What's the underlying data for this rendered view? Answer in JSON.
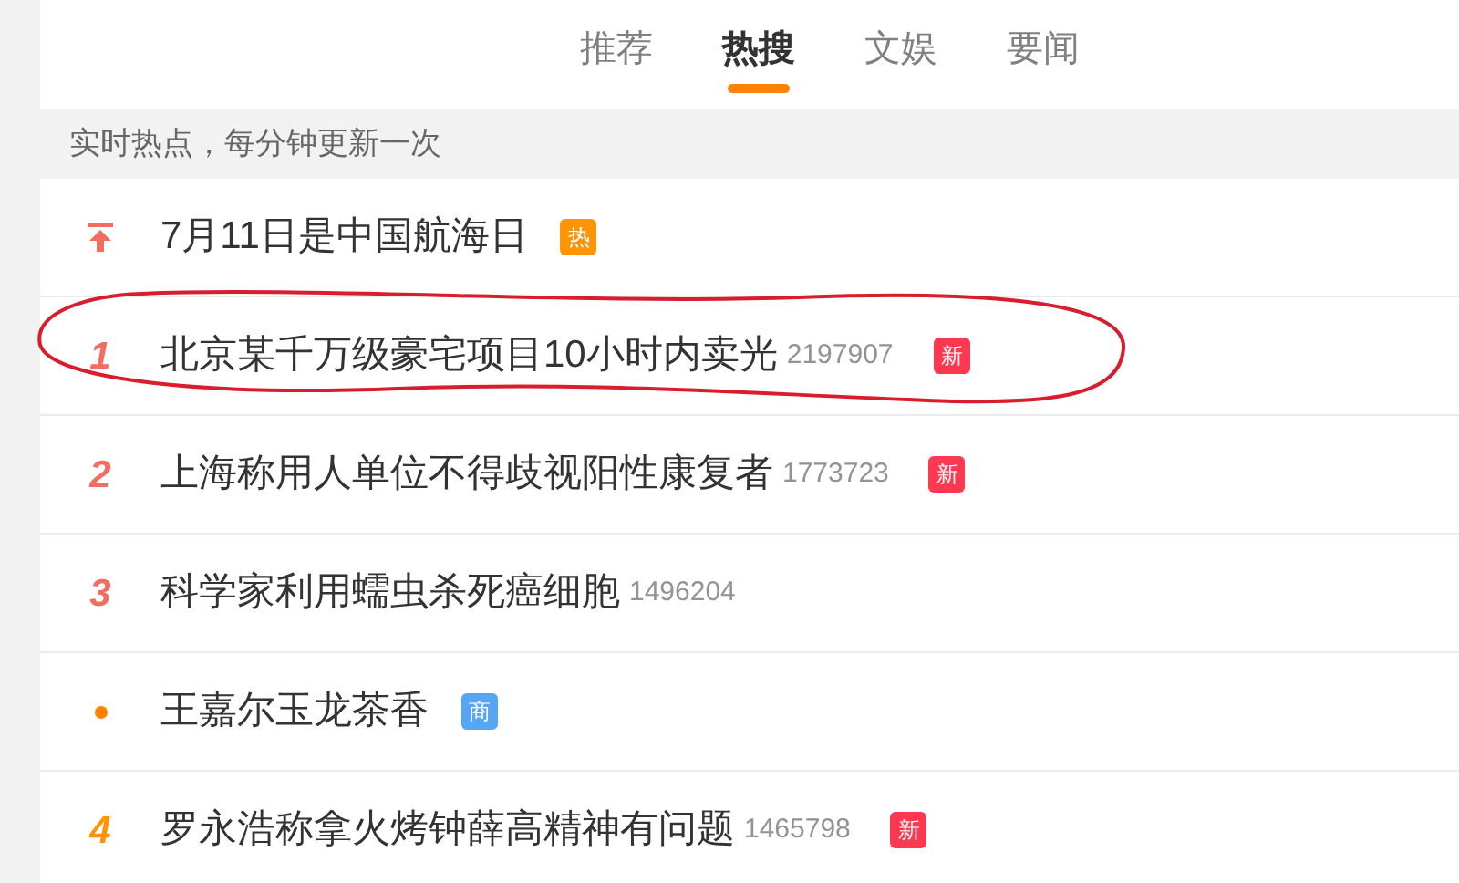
{
  "tabs": [
    {
      "label": "推荐",
      "selected": false
    },
    {
      "label": "热搜",
      "selected": true
    },
    {
      "label": "文娱",
      "selected": false
    },
    {
      "label": "要闻",
      "selected": false
    }
  ],
  "notice": "实时热点，每分钟更新一次",
  "items": [
    {
      "rank": {
        "kind": "top",
        "color": "#f26d5f"
      },
      "title": "7月11日是中国航海日",
      "badge": {
        "text": "热",
        "color": "#ff9406"
      },
      "circled": false
    },
    {
      "rank": {
        "kind": "number",
        "text": "1",
        "color": "#f26d5f"
      },
      "title": "北京某千万级豪宅项目10小时内卖光",
      "count": "2197907",
      "badge": {
        "text": "新",
        "color": "#ff3852"
      },
      "circled": true
    },
    {
      "rank": {
        "kind": "number",
        "text": "2",
        "color": "#f26d5f"
      },
      "title": "上海称用人单位不得歧视阳性康复者",
      "count": "1773723",
      "badge": {
        "text": "新",
        "color": "#ff3852"
      },
      "circled": false
    },
    {
      "rank": {
        "kind": "number",
        "text": "3",
        "color": "#f26d5f"
      },
      "title": "科学家利用蠕虫杀死癌细胞",
      "count": "1496204",
      "circled": false
    },
    {
      "rank": {
        "kind": "dot",
        "color": "#ff8200"
      },
      "title": "王嘉尔玉龙茶香",
      "badge": {
        "text": "商",
        "color": "#56a6f5"
      },
      "circled": false
    },
    {
      "rank": {
        "kind": "number",
        "text": "4",
        "color": "#ff9406"
      },
      "title": "罗永浩称拿火烤钟薛高精神有问题",
      "count": "1465798",
      "badge": {
        "text": "新",
        "color": "#ff3852"
      },
      "circled": false
    }
  ]
}
